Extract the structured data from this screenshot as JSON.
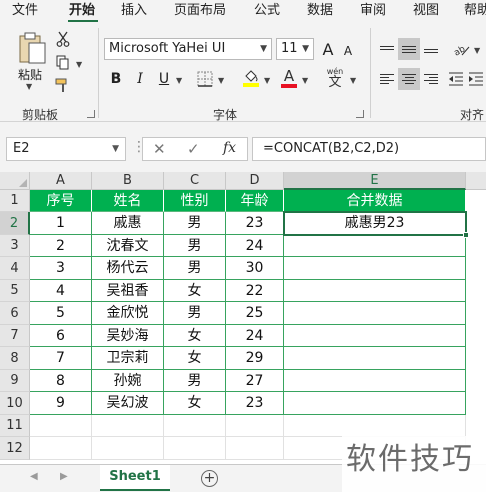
{
  "ribbon": {
    "tabs": [
      "文件",
      "开始",
      "插入",
      "页面布局",
      "公式",
      "数据",
      "审阅",
      "视图",
      "帮助"
    ],
    "active_tab": "开始",
    "clipboard": {
      "paste_label": "粘贴",
      "group_label": "剪贴板"
    },
    "font": {
      "name": "Microsoft YaHei UI",
      "size": "11",
      "bold": "B",
      "italic": "I",
      "underline": "U",
      "grow": "A",
      "shrink": "A",
      "color_glyph": "A",
      "wen_top": "wén",
      "wen_bottom": "文",
      "group_label": "字体"
    },
    "alignment": {
      "group_label": "对齐"
    }
  },
  "formula_bar": {
    "name_box": "E2",
    "cancel": "✕",
    "confirm": "✓",
    "fx": "fx",
    "formula": "=CONCAT(B2,C2,D2)"
  },
  "grid": {
    "columns": [
      "A",
      "B",
      "C",
      "D",
      "E"
    ],
    "selected_column": "E",
    "rows": [
      "1",
      "2",
      "3",
      "4",
      "5",
      "6",
      "7",
      "8",
      "9",
      "10",
      "11",
      "12"
    ],
    "selected_row": "2",
    "header_row": [
      "序号",
      "姓名",
      "性别",
      "年龄",
      "合并数据"
    ],
    "data_rows": [
      [
        "1",
        "戚惠",
        "男",
        "23",
        "戚惠男23"
      ],
      [
        "2",
        "沈春文",
        "男",
        "24",
        ""
      ],
      [
        "3",
        "杨代云",
        "男",
        "30",
        ""
      ],
      [
        "4",
        "吴祖香",
        "女",
        "22",
        ""
      ],
      [
        "5",
        "金欣悦",
        "男",
        "25",
        ""
      ],
      [
        "6",
        "吴妙海",
        "女",
        "24",
        ""
      ],
      [
        "7",
        "卫宗莉",
        "女",
        "29",
        ""
      ],
      [
        "8",
        "孙婉",
        "男",
        "27",
        ""
      ],
      [
        "9",
        "吴幻波",
        "女",
        "23",
        ""
      ]
    ],
    "active_cell": "E2",
    "header_color": "#00b050",
    "accent_color": "#217346"
  },
  "sheets": {
    "tabs": [
      "Sheet1"
    ],
    "active": "Sheet1",
    "add_icon": "plus-circle-icon",
    "prev_icon": "caret-left-icon",
    "next_icon": "caret-right-icon"
  },
  "watermark": "软件技巧"
}
